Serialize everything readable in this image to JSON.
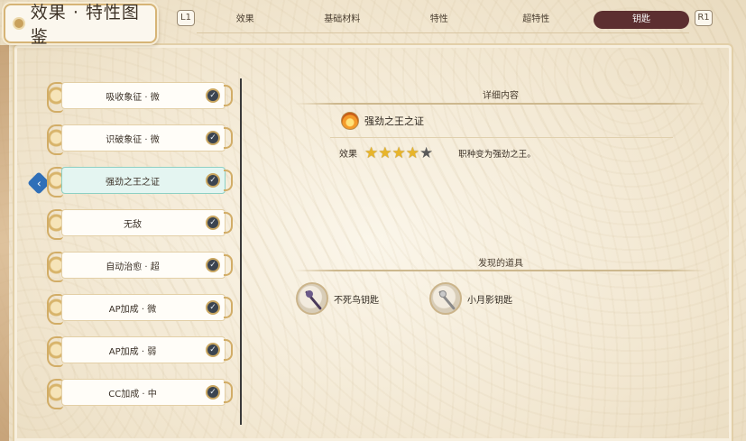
{
  "header": {
    "title": "效果 · 特性图鉴",
    "l_button": "L1",
    "r_button": "R1",
    "tabs": [
      {
        "label": "效果",
        "active": false
      },
      {
        "label": "基础材料",
        "active": false
      },
      {
        "label": "特性",
        "active": false
      },
      {
        "label": "超特性",
        "active": false
      },
      {
        "label": "钥匙",
        "active": true
      }
    ]
  },
  "list": {
    "items": [
      {
        "label": "吸收象征 · 微",
        "checked": true
      },
      {
        "label": "识破象征 · 微",
        "checked": true
      },
      {
        "label": "强劲之王之证",
        "checked": true,
        "selected": true
      },
      {
        "label": "无敌",
        "checked": true
      },
      {
        "label": "自动治愈 · 超",
        "checked": true
      },
      {
        "label": "AP加成 · 微",
        "checked": true
      },
      {
        "label": "AP加成 · 弱",
        "checked": true
      },
      {
        "label": "CC加成 · 中",
        "checked": true
      }
    ]
  },
  "detail": {
    "section_detail": "详细内容",
    "trait_icon": "flame-icon",
    "trait_name": "强劲之王之证",
    "effect_label": "效果",
    "stars_filled": 4,
    "stars_total": 5,
    "effect_desc": "职种变为强劲之王。",
    "section_found": "发现的道具",
    "found_items": [
      {
        "name": "不死鸟钥匙",
        "icon": "dark-key-icon"
      },
      {
        "name": "小月影钥匙",
        "icon": "silver-key-icon"
      }
    ]
  },
  "colors": {
    "active_tab_bg": "#5c2f30",
    "selected_item_bg": "#e4f5f1",
    "cursor": "#2f6fb8",
    "star": "#e8b52a"
  }
}
